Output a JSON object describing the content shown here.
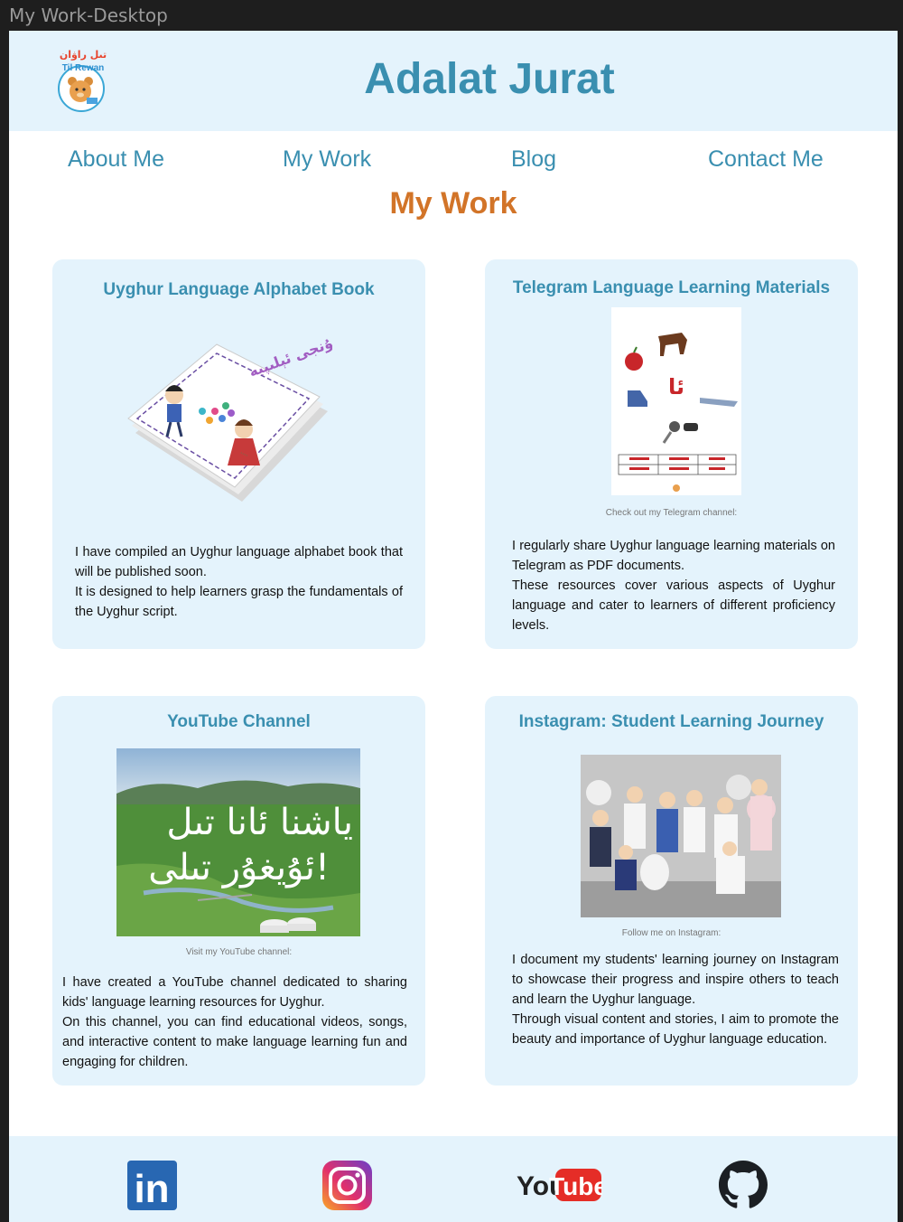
{
  "window": {
    "title": "My Work-Desktop"
  },
  "header": {
    "site_title": "Adalat Jurat",
    "logo_text": "Til Rewan",
    "logo_text_uyghur": "تىل راۋان"
  },
  "nav": {
    "items": [
      "About Me",
      "My Work",
      "Blog",
      "Contact Me"
    ]
  },
  "page": {
    "heading": "My Work"
  },
  "cards": [
    {
      "title": "Uyghur Language Alphabet Book",
      "cover_title": "تۇنجى ئېلىپبە",
      "paragraphs": [
        "I have compiled an Uyghur language alphabet book that will be published soon.",
        "It is designed to help learners grasp the fundamentals of the Uyghur script."
      ]
    },
    {
      "title": "Telegram Language Learning Materials",
      "letter": "ئا",
      "caption": "Check out my Telegram channel:",
      "paragraphs": [
        "I regularly share Uyghur language learning materials on Telegram as PDF documents.",
        "These resources cover various aspects of Uyghur language and cater to learners of different proficiency levels."
      ]
    },
    {
      "title": "YouTube Channel",
      "banner_line1": "ياشنا ئانا تىل",
      "banner_line2": "ئۇيغۇر تىلى!",
      "caption": "Visit my YouTube channel:",
      "paragraphs": [
        "I have created a YouTube channel dedicated to sharing kids' language learning resources for Uyghur.",
        "On this channel, you can find educational videos, songs, and interactive content to make language learning fun and engaging for children."
      ]
    },
    {
      "title": "Instagram: Student Learning Journey",
      "caption": "Follow me on Instagram:",
      "paragraphs": [
        "I document my students' learning journey on Instagram to showcase their progress and inspire others to teach and learn the Uyghur language.",
        "Through visual content and stories, I aim to promote the beauty and importance of Uyghur language education."
      ]
    }
  ],
  "footer": {
    "icons": [
      "linkedin-icon",
      "instagram-icon",
      "youtube-icon",
      "github-icon"
    ],
    "linkedin_text": "in",
    "youtube_you": "You",
    "youtube_tube": "Tube"
  },
  "colors": {
    "accent": "#3a8fb0",
    "heading": "#d27428",
    "panel": "#e4f3fc"
  }
}
